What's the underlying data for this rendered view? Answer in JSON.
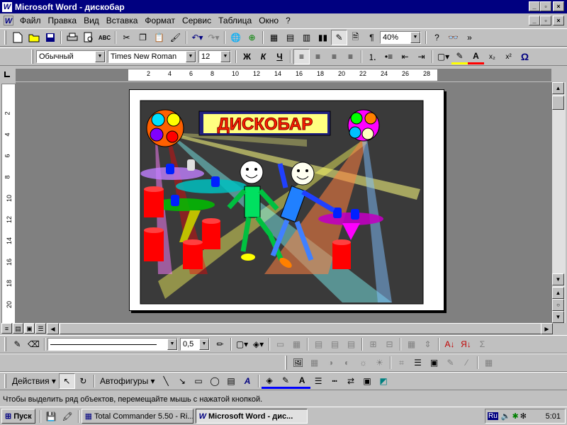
{
  "window": {
    "title": "Microsoft Word - дискобар"
  },
  "menu": [
    "Файл",
    "Правка",
    "Вид",
    "Вставка",
    "Формат",
    "Сервис",
    "Таблица",
    "Окно",
    "?"
  ],
  "standard_toolbar": {
    "zoom": "40%"
  },
  "format_toolbar": {
    "style": "Обычный",
    "font": "Times New Roman",
    "size": "12",
    "bold": "Ж",
    "italic": "К",
    "underline": "Ч",
    "omega": "Ω"
  },
  "ruler": {
    "h_ticks": [
      "2",
      "4",
      "6",
      "8",
      "10",
      "12",
      "14",
      "16",
      "18",
      "20",
      "22",
      "24",
      "26",
      "28"
    ],
    "v_ticks": [
      "2",
      "4",
      "6",
      "8",
      "10",
      "12",
      "14",
      "16",
      "18",
      "20"
    ]
  },
  "document": {
    "banner_text": "ДИСКОБАР",
    "colors": {
      "background": "#3a3a3a",
      "banner": "#ff2000",
      "banner_bg": "#ffff80"
    }
  },
  "drawing_toolbar1": {
    "line_weight": "0,5"
  },
  "drawing_toolbar2": {
    "actions": "Действия",
    "autoshapes": "Автофигуры"
  },
  "status": {
    "text": "Чтобы выделить ряд объектов, перемещайте мышь с нажатой кнопкой."
  },
  "taskbar": {
    "start": "Пуск",
    "tasks": [
      "Total Commander 5.50 - Ri...",
      "Microsoft Word - дис..."
    ],
    "lang": "Ru",
    "clock": "5:01"
  }
}
